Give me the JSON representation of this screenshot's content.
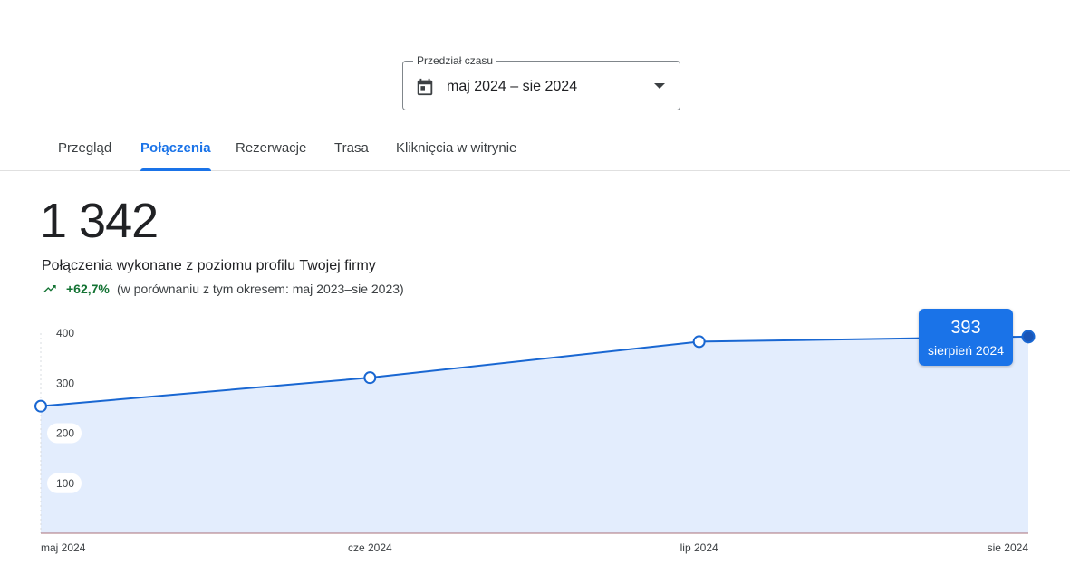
{
  "date_range": {
    "label": "Przedział czasu",
    "value": "maj 2024 – sie 2024",
    "icon": "calendar-icon"
  },
  "tabs": [
    {
      "label": "Przegląd",
      "active": false
    },
    {
      "label": "Połączenia",
      "active": true
    },
    {
      "label": "Rezerwacje",
      "active": false
    },
    {
      "label": "Trasa",
      "active": false
    },
    {
      "label": "Kliknięcia w witrynie",
      "active": false
    }
  ],
  "metric": {
    "value": "1 342",
    "description": "Połączenia wykonane z poziomu profilu Twojej firmy",
    "change": "+62,7%",
    "comparison": "(w porównaniu z tym okresem: maj 2023–sie 2023)",
    "trend_icon": "trending-up-icon"
  },
  "tooltip": {
    "value": "393",
    "label": "sierpień 2024"
  },
  "colors": {
    "accent": "#1a73e8",
    "line": "#1967d2",
    "area": "#e3edfd",
    "positive": "#137333"
  },
  "chart_data": {
    "type": "area",
    "x": [
      "maj 2024",
      "cze 2024",
      "lip 2024",
      "sie 2024"
    ],
    "series": [
      {
        "values": [
          254,
          311,
          383,
          393
        ]
      }
    ],
    "yticks": [
      100,
      200,
      300,
      400
    ],
    "ylim": [
      0,
      400
    ],
    "xlabel": "",
    "ylabel": "",
    "highlighted_index": 3
  }
}
